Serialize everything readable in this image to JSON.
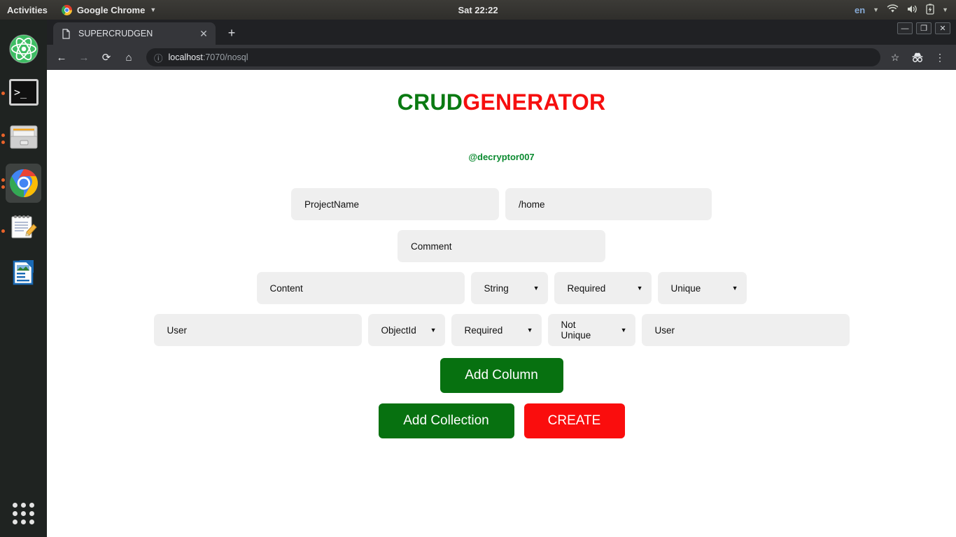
{
  "topbar": {
    "activities": "Activities",
    "app_name": "Google Chrome",
    "app_caret": "▼",
    "clock": "Sat 22:22",
    "language": "en",
    "lang_caret": "▼",
    "tray_caret": "▼",
    "icons": [
      "wifi-icon",
      "volume-icon",
      "battery-icon"
    ]
  },
  "dock": {
    "items": [
      {
        "name": "atom",
        "label": "Atom",
        "running": false,
        "active": false
      },
      {
        "name": "terminal",
        "label": "Terminal",
        "running": true,
        "active": false
      },
      {
        "name": "files",
        "label": "Files",
        "running": true,
        "active": false
      },
      {
        "name": "chrome",
        "label": "Google Chrome",
        "running": true,
        "active": true
      },
      {
        "name": "text-editor",
        "label": "Text Editor",
        "running": true,
        "active": false
      },
      {
        "name": "libreoffice-writer",
        "label": "LibreOffice Writer",
        "running": false,
        "active": false
      }
    ],
    "show_apps_label": "Show Applications"
  },
  "browser": {
    "tab": {
      "title": "SUPERCRUDGEN",
      "close_label": "✕",
      "favicon": "page-icon"
    },
    "new_tab_label": "+",
    "window_controls": {
      "minimize": "—",
      "maximize": "❐",
      "close": "✕"
    },
    "nav": {
      "back": "←",
      "forward": "→",
      "reload": "⟳",
      "home": "⌂"
    },
    "omnibox": {
      "info_icon": "ⓘ",
      "host": "localhost",
      "path": ":7070/nosql",
      "full_url": "localhost:7070/nosql"
    },
    "omnibox_actions": {
      "bookmark": "☆",
      "incognito": "incognito-icon",
      "menu": "⋮"
    }
  },
  "page": {
    "logo": {
      "part1": "CRUD",
      "part2": "GENERATOR",
      "color1": "#0a7a12",
      "color2": "#f60f0f"
    },
    "handle": "@decryptor007",
    "fields": {
      "project_name": "ProjectName",
      "project_path": "/home",
      "comment": "Comment"
    },
    "columns": [
      {
        "name": "Content",
        "type": "String",
        "required": "Required",
        "unique": "Unique",
        "reference": null
      },
      {
        "name": "User",
        "type": "ObjectId",
        "required": "Required",
        "unique": "Not Unique",
        "reference": "User"
      }
    ],
    "dropdown_arrow": "▼",
    "buttons": {
      "add_column": "Add Column",
      "add_collection": "Add Collection",
      "create": "CREATE"
    }
  }
}
